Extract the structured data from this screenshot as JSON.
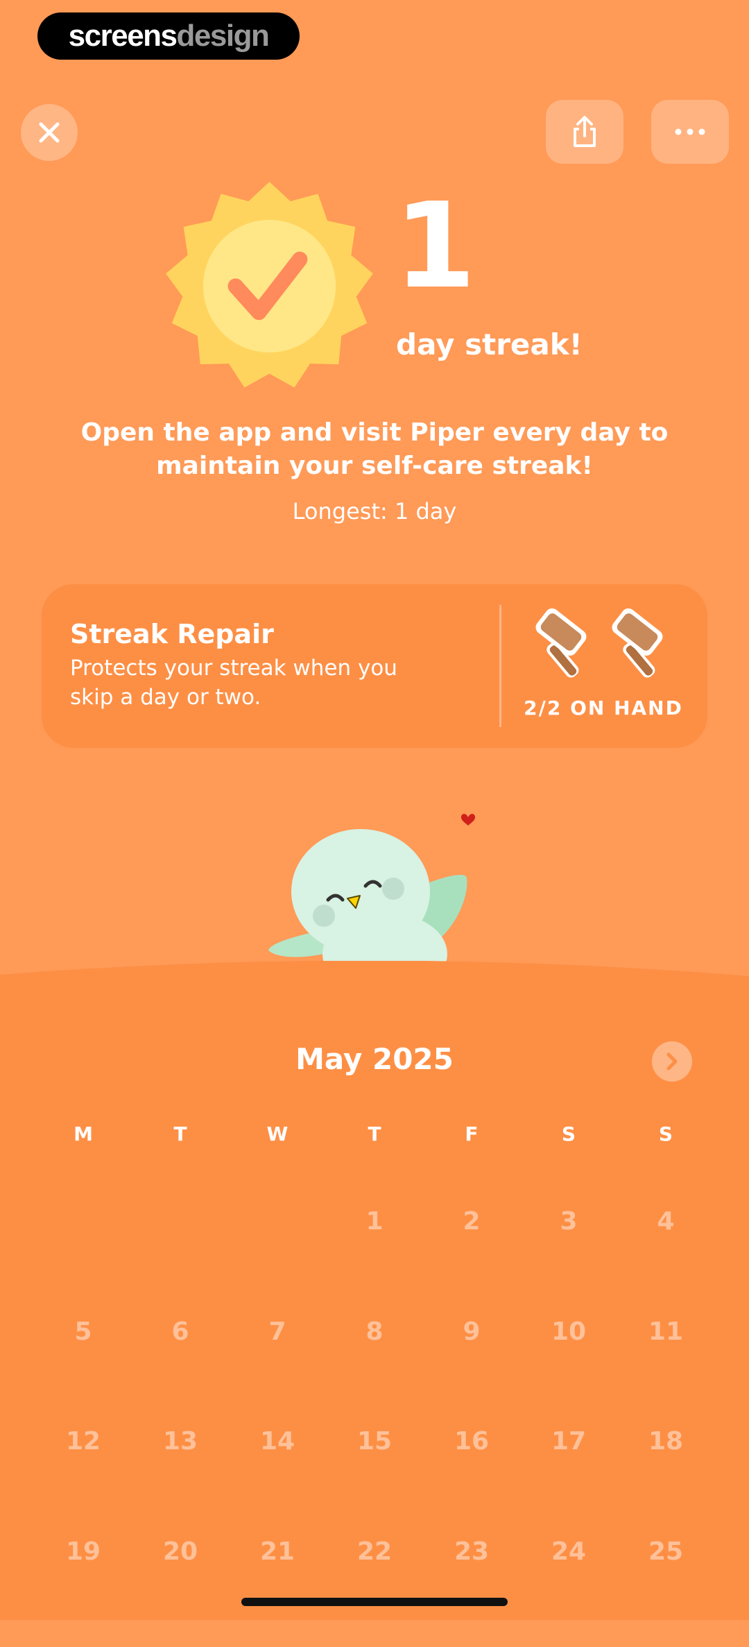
{
  "watermark": {
    "part1": "screens",
    "part2": "design"
  },
  "header": {
    "close_icon": "close-icon",
    "share_icon": "share-icon",
    "more_icon": "more-icon"
  },
  "streak": {
    "count": "1",
    "label": "day streak!",
    "message": "Open the app and visit Piper every day to maintain your self-care streak!",
    "longest": "Longest: 1 day"
  },
  "repair": {
    "title": "Streak Repair",
    "description": "Protects your streak when you skip a day or two.",
    "on_hand": "2/2 ON HAND",
    "on_hand_count": 2,
    "capacity": 2
  },
  "calendar": {
    "month": "May 2025",
    "weekdays": [
      "M",
      "T",
      "W",
      "T",
      "F",
      "S",
      "S"
    ],
    "blank_leading_days": 3,
    "days": [
      "1",
      "2",
      "3",
      "4",
      "5",
      "6",
      "7",
      "8",
      "9",
      "10",
      "11",
      "12",
      "13",
      "14",
      "15",
      "16",
      "17",
      "18",
      "19",
      "20",
      "21",
      "22",
      "23",
      "24",
      "25"
    ]
  },
  "colors": {
    "background": "#FF9A57",
    "card": "#FD8F45",
    "sun": "#FFD45E",
    "check": "#FF8A5C",
    "bird": "#D8F2E3"
  }
}
